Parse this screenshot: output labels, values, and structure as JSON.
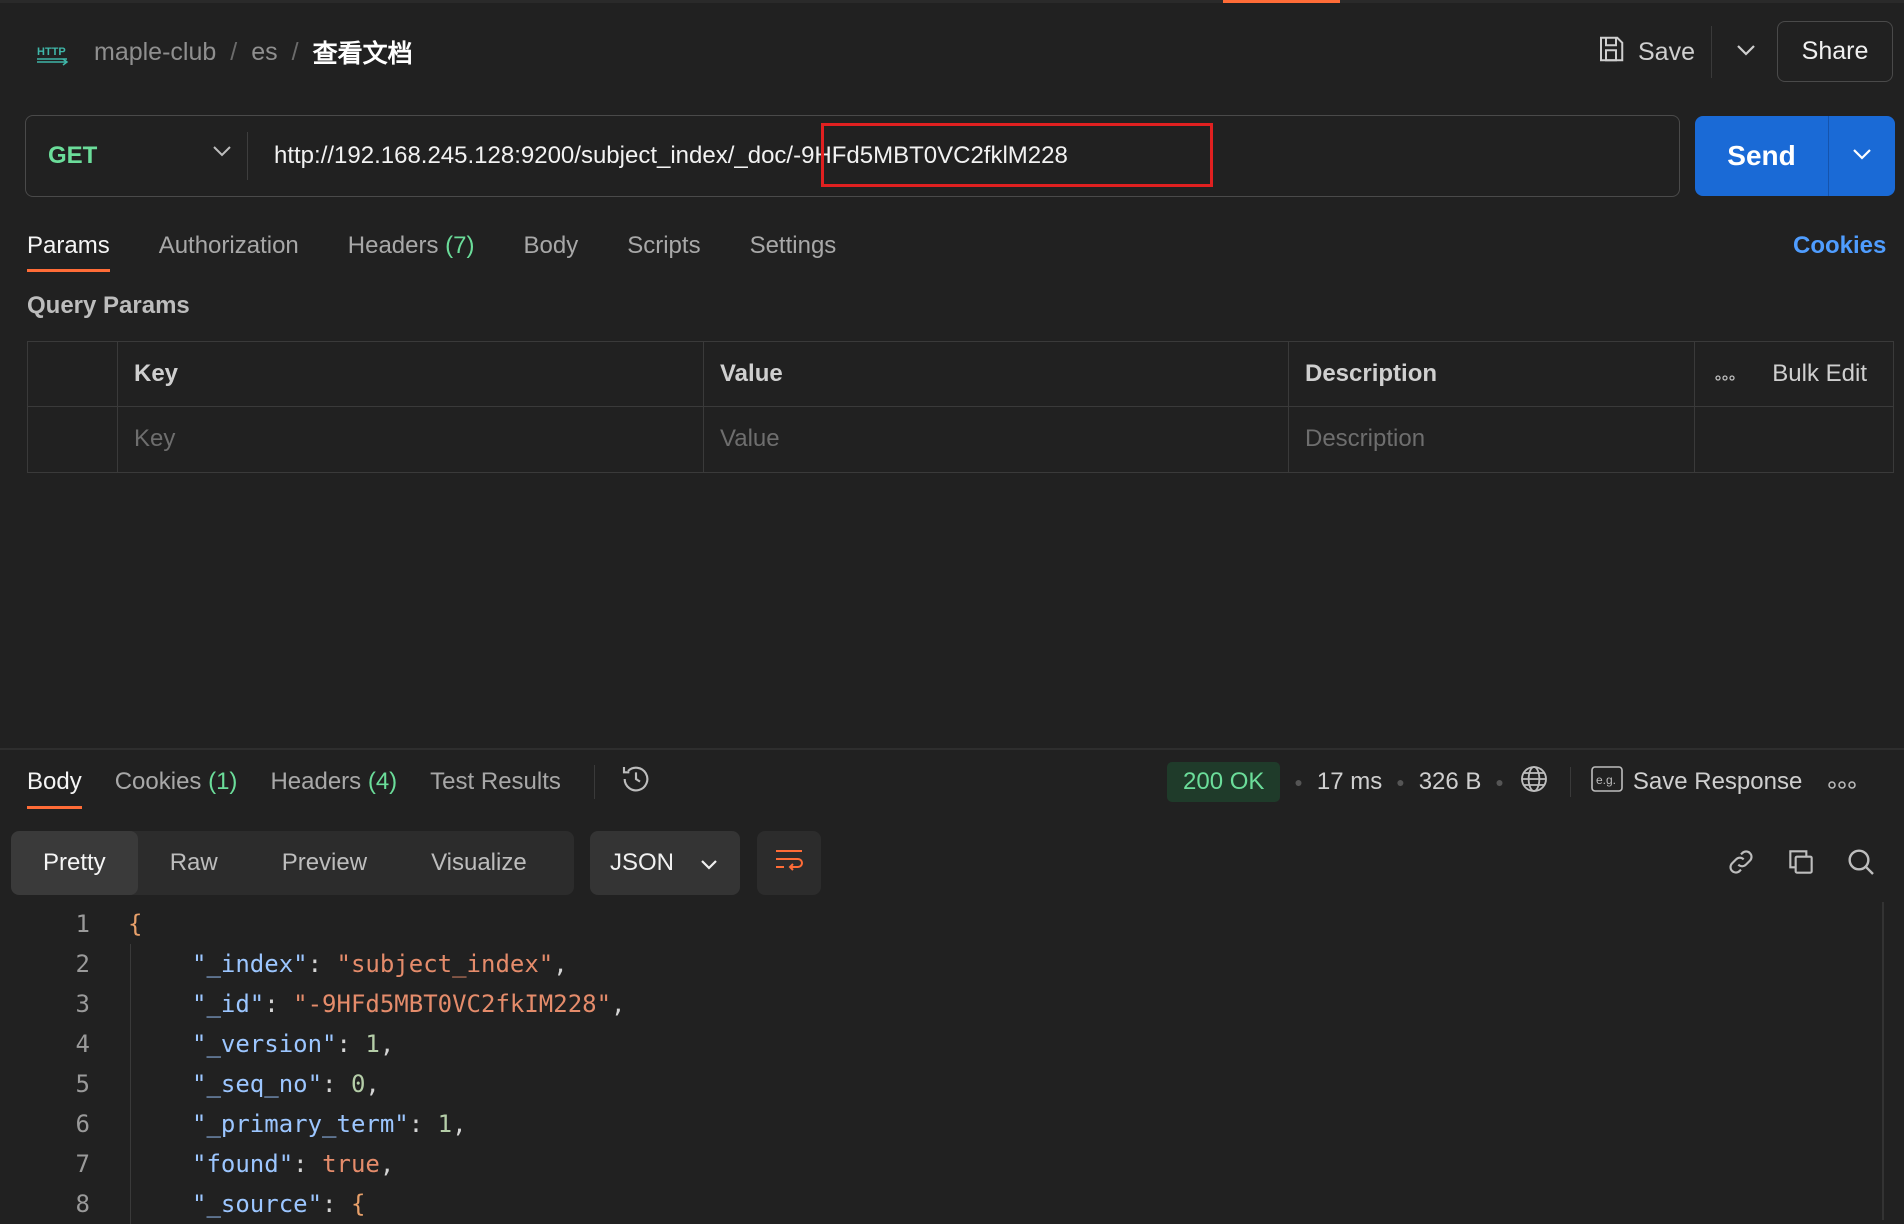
{
  "breadcrumb": {
    "icon": "http-icon",
    "items": [
      "maple-club",
      "es"
    ],
    "separator": "/",
    "current": "查看文档"
  },
  "header": {
    "save_label": "Save",
    "share_label": "Share"
  },
  "request": {
    "method": "GET",
    "url": "http://192.168.245.128:9200/subject_index/_doc/-9HFd5MBT0VC2fklM228",
    "send_label": "Send"
  },
  "request_tabs": [
    {
      "label": "Params",
      "active": true
    },
    {
      "label": "Authorization"
    },
    {
      "label": "Headers",
      "count": "(7)"
    },
    {
      "label": "Body"
    },
    {
      "label": "Scripts"
    },
    {
      "label": "Settings"
    }
  ],
  "cookies_link": "Cookies",
  "query_params": {
    "title": "Query Params",
    "headers": [
      "Key",
      "Value",
      "Description"
    ],
    "bulk_edit": "Bulk Edit",
    "placeholders": [
      "Key",
      "Value",
      "Description"
    ]
  },
  "response": {
    "tabs": [
      {
        "label": "Body",
        "active": true
      },
      {
        "label": "Cookies",
        "count": "(1)"
      },
      {
        "label": "Headers",
        "count": "(4)"
      },
      {
        "label": "Test Results"
      }
    ],
    "status": "200 OK",
    "time": "17 ms",
    "size": "326 B",
    "save_response": "Save Response",
    "views": [
      "Pretty",
      "Raw",
      "Preview",
      "Visualize"
    ],
    "format": "JSON",
    "code_lines": [
      {
        "n": "1",
        "parts": [
          [
            "b",
            "{"
          ]
        ]
      },
      {
        "n": "2",
        "parts": [
          [
            "k",
            "\"_index\""
          ],
          [
            "p",
            ": "
          ],
          [
            "s",
            "\"subject_index\""
          ],
          [
            "p",
            ","
          ]
        ]
      },
      {
        "n": "3",
        "parts": [
          [
            "k",
            "\"_id\""
          ],
          [
            "p",
            ": "
          ],
          [
            "s",
            "\"-9HFd5MBT0VC2fkIM228\""
          ],
          [
            "p",
            ","
          ]
        ]
      },
      {
        "n": "4",
        "parts": [
          [
            "k",
            "\"_version\""
          ],
          [
            "p",
            ": "
          ],
          [
            "n",
            "1"
          ],
          [
            "p",
            ","
          ]
        ]
      },
      {
        "n": "5",
        "parts": [
          [
            "k",
            "\"_seq_no\""
          ],
          [
            "p",
            ": "
          ],
          [
            "n",
            "0"
          ],
          [
            "p",
            ","
          ]
        ]
      },
      {
        "n": "6",
        "parts": [
          [
            "k",
            "\"_primary_term\""
          ],
          [
            "p",
            ": "
          ],
          [
            "n",
            "1"
          ],
          [
            "p",
            ","
          ]
        ]
      },
      {
        "n": "7",
        "parts": [
          [
            "k",
            "\"found\""
          ],
          [
            "p",
            ": "
          ],
          [
            "s",
            "true"
          ],
          [
            "p",
            ","
          ]
        ]
      },
      {
        "n": "8",
        "parts": [
          [
            "k",
            "\"_source\""
          ],
          [
            "p",
            ": "
          ],
          [
            "b",
            "{"
          ]
        ]
      }
    ]
  },
  "colors": {
    "accent": "#ff6c37",
    "send": "#1a6ad6",
    "get": "#6bdd9a",
    "link": "#4f9dff",
    "highlight": "#e02020"
  }
}
